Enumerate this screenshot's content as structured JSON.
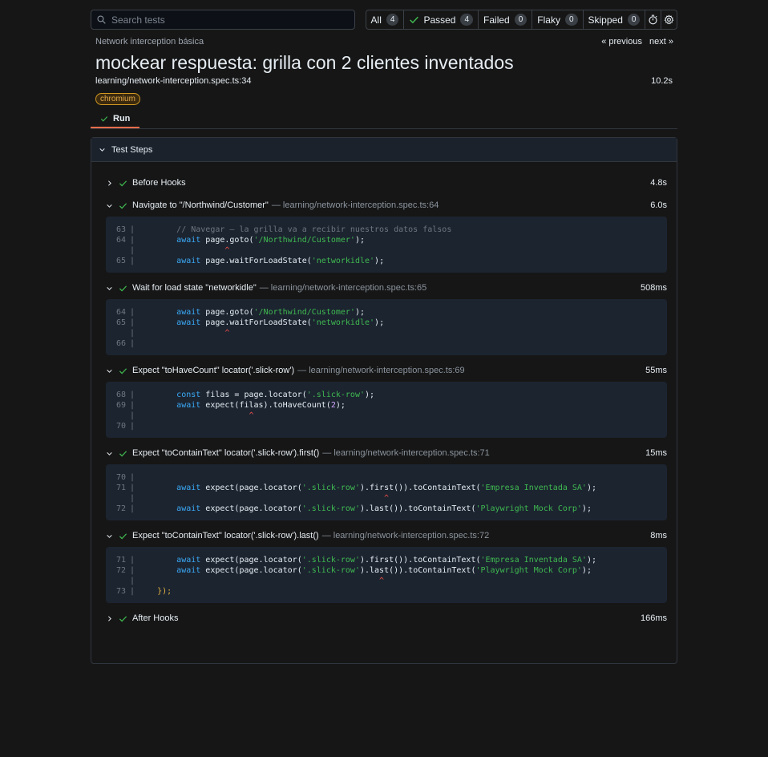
{
  "search": {
    "placeholder": "Search tests"
  },
  "filters": [
    {
      "label": "All",
      "count": "4"
    },
    {
      "label": "Passed",
      "count": "4"
    },
    {
      "label": "Failed",
      "count": "0"
    },
    {
      "label": "Flaky",
      "count": "0"
    },
    {
      "label": "Skipped",
      "count": "0"
    }
  ],
  "header": {
    "suite": "Network interception básica",
    "prev": "« previous",
    "next": "next »",
    "title": "mockear respuesta: grilla con 2 clientes inventados",
    "file": "learning/network-interception.spec.ts:34",
    "duration": "10.2s",
    "tag": "chromium"
  },
  "tabs": {
    "run": "Run"
  },
  "steps_title": "Test Steps",
  "steps": [
    {
      "label": "Before Hooks",
      "loc": "",
      "dur": "4.8s"
    },
    {
      "label": "Navigate to \"/Northwind/Customer\"",
      "loc": "— learning/network-interception.spec.ts:64",
      "dur": "6.0s"
    },
    {
      "label": "Wait for load state \"networkidle\"",
      "loc": "— learning/network-interception.spec.ts:65",
      "dur": "508ms"
    },
    {
      "label": "Expect \"toHaveCount\" locator('.slick-row')",
      "loc": "— learning/network-interception.spec.ts:69",
      "dur": "55ms"
    },
    {
      "label": "Expect \"toContainText\" locator('.slick-row').first()",
      "loc": "— learning/network-interception.spec.ts:71",
      "dur": "15ms"
    },
    {
      "label": "Expect \"toContainText\" locator('.slick-row').last()",
      "loc": "— learning/network-interception.spec.ts:72",
      "dur": "8ms"
    },
    {
      "label": "After Hooks",
      "loc": "",
      "dur": "166ms"
    }
  ],
  "code": {
    "c1": {
      "l1": "63",
      "t1": "// Navegar — la grilla va a recibir nuestros datos falsos",
      "l2": "64",
      "t2a": "await",
      "t2b": " page.goto(",
      "t2c": "'/Northwind/Customer'",
      "t2d": ");",
      "caret": "^",
      "l3": "65",
      "t3a": "await",
      "t3b": " page.waitForLoadState(",
      "t3c": "'networkidle'",
      "t3d": ");"
    },
    "c2": {
      "l1": "64",
      "t1a": "await",
      "t1b": " page.goto(",
      "t1c": "'/Northwind/Customer'",
      "t1d": ");",
      "l2": "65",
      "t2a": "await",
      "t2b": " page.waitForLoadState(",
      "t2c": "'networkidle'",
      "t2d": ");",
      "caret": "^",
      "l3": "66"
    },
    "c3": {
      "l1": "68",
      "t1a": "const",
      "t1b": " filas = page.locator(",
      "t1c": "'.slick-row'",
      "t1d": ");",
      "l2": "69",
      "t2a": "await",
      "t2b": " expect(filas).toHaveCount(",
      "t2c": "2",
      "t2d": ");",
      "caret": "^",
      "l3": "70"
    },
    "c4": {
      "l1": "70",
      "l2": "71",
      "t2a": "await",
      "t2b": " expect(page.locator(",
      "t2c": "'.slick-row'",
      "t2d": ").first()).toContainText(",
      "t2e": "'Empresa Inventada SA'",
      "t2f": ");",
      "caret": "^",
      "l3": "72",
      "t3a": "await",
      "t3b": " expect(page.locator(",
      "t3c": "'.slick-row'",
      "t3d": ").last()).toContainText(",
      "t3e": "'Playwright Mock Corp'",
      "t3f": ");"
    },
    "c5": {
      "l1": "71",
      "t1a": "await",
      "t1b": " expect(page.locator(",
      "t1c": "'.slick-row'",
      "t1d": ").first()).toContainText(",
      "t1e": "'Empresa Inventada SA'",
      "t1f": ");",
      "l2": "72",
      "t2a": "await",
      "t2b": " expect(page.locator(",
      "t2c": "'.slick-row'",
      "t2d": ").last()).toContainText(",
      "t2e": "'Playwright Mock Corp'",
      "t2f": ");",
      "caret": "^",
      "l3": "73",
      "t3": "});"
    }
  },
  "colors": {
    "accent": "#ef6e4a",
    "pass": "#3fb950",
    "tag": "#d29922"
  }
}
